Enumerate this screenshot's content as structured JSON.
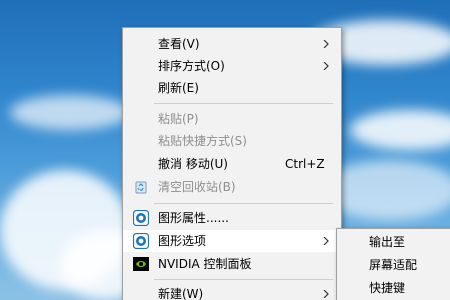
{
  "context_menu": {
    "items": [
      {
        "label": "查看(V)"
      },
      {
        "label": "排序方式(O)"
      },
      {
        "label": "刷新(E)"
      },
      {
        "label": "粘贴(P)"
      },
      {
        "label": "粘贴快捷方式(S)"
      },
      {
        "label": "撤消 移动(U)",
        "shortcut": "Ctrl+Z"
      },
      {
        "label": "清空回收站(B)"
      },
      {
        "label": "图形属性......"
      },
      {
        "label": "图形选项"
      },
      {
        "label": "NVIDIA 控制面板"
      },
      {
        "label": "新建(W)"
      }
    ]
  },
  "submenu": {
    "items": [
      {
        "label": "输出至"
      },
      {
        "label": "屏幕适配"
      },
      {
        "label": "快捷键"
      }
    ]
  },
  "icons": {
    "recycle": "recycle-bin-icon",
    "graphics_properties": "intel-graphics-icon",
    "graphics_options": "intel-graphics-icon",
    "nvidia": "nvidia-logo-icon",
    "submenu_arrow": "chevron-right-icon"
  },
  "colors": {
    "menu_background": "#f2f2f2",
    "highlight": "#ffffff",
    "disabled_text": "#8f8f8f",
    "intel_blue": "#1e73be",
    "nvidia_green": "#76b900"
  }
}
